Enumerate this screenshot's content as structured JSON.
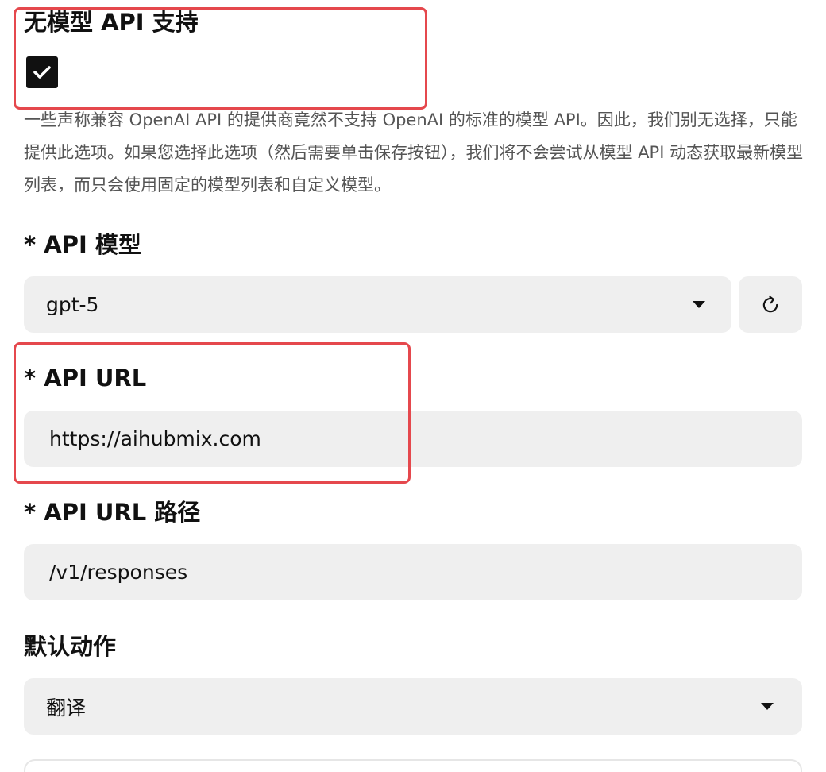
{
  "no_model_api": {
    "title": "无模型 API 支持",
    "checked": true,
    "check_icon": "check-icon",
    "description": "一些声称兼容 OpenAI API 的提供商竟然不支持 OpenAI 的标准的模型 API。因此，我们别无选择，只能提供此选项。如果您选择此选项（然后需要单击保存按钮），我们将不会尝试从模型 API 动态获取最新模型列表，而只会使用固定的模型列表和自定义模型。"
  },
  "api_model": {
    "label": "* API 模型",
    "value": "gpt-5",
    "dropdown_icon": "chevron-down-icon",
    "refresh_icon": "refresh-icon"
  },
  "api_url": {
    "label": "* API URL",
    "value": "https://aihubmix.com"
  },
  "api_url_path": {
    "label": "* API URL 路径",
    "value": "/v1/responses"
  },
  "default_action": {
    "label": "默认动作",
    "value": "翻译",
    "dropdown_icon": "chevron-down-icon"
  },
  "colors": {
    "highlight": "#e5484d",
    "field_bg": "#efefef",
    "text": "#111111",
    "muted_text": "#555555"
  }
}
